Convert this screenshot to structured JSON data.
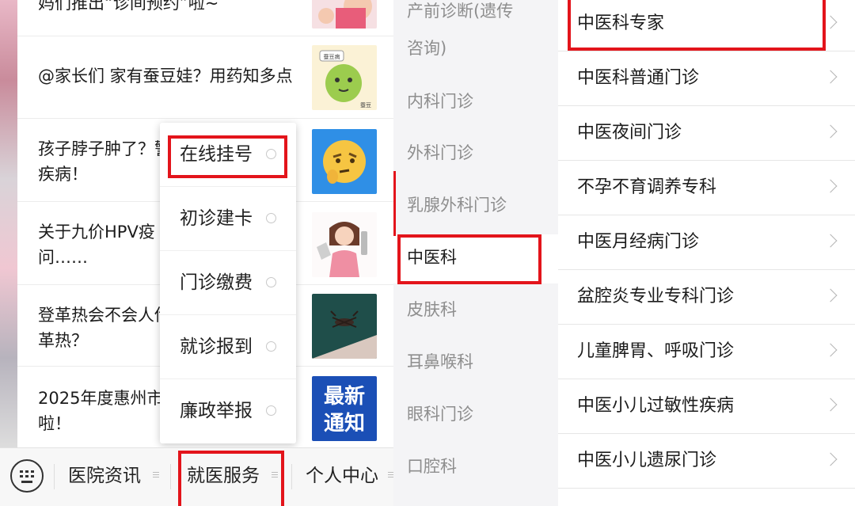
{
  "feed": {
    "items": [
      {
        "title": "妈们推出“诊间预约”啦~"
      },
      {
        "title": "@家长们 家有蚕豆娃？用药知多点"
      },
      {
        "title": "孩子脖子肿了？警惕",
        "title2": "疾病！"
      },
      {
        "title": "关于九价HPV疫",
        "title2": "问……"
      },
      {
        "title": "登革热会不会人传",
        "title2": "革热？"
      },
      {
        "title": "2025年度惠州市",
        "title2": "啦！"
      }
    ],
    "thumb_captions": {
      "sign": "蚕豆病",
      "tag": "蚕豆",
      "news_line1": "最新",
      "news_line2": "通知"
    }
  },
  "service_menu": {
    "items": [
      {
        "label": "在线挂号"
      },
      {
        "label": "初诊建卡"
      },
      {
        "label": "门诊缴费"
      },
      {
        "label": "就诊报到"
      },
      {
        "label": "廉政举报"
      }
    ]
  },
  "bottom_nav": {
    "tabs": [
      {
        "label": "医院资讯"
      },
      {
        "label": "就医服务"
      },
      {
        "label": "个人中心"
      }
    ]
  },
  "departments": {
    "items": [
      {
        "label": "产前诊断(遗传",
        "label2": "咨询)"
      },
      {
        "label": "内科门诊"
      },
      {
        "label": "外科门诊"
      },
      {
        "label": "乳腺外科门诊"
      },
      {
        "label": "中医科"
      },
      {
        "label": "皮肤科"
      },
      {
        "label": "耳鼻喉科"
      },
      {
        "label": "眼科门诊"
      },
      {
        "label": "口腔科"
      }
    ],
    "selected": "中医科"
  },
  "clinics": {
    "items": [
      {
        "label": "中医科专家"
      },
      {
        "label": "中医科普通门诊"
      },
      {
        "label": "中医夜间门诊"
      },
      {
        "label": "不孕不育调养专科"
      },
      {
        "label": "中医月经病门诊"
      },
      {
        "label": "盆腔炎专业专科门诊"
      },
      {
        "label": "儿童脾胃、呼吸门诊"
      },
      {
        "label": "中医小儿过敏性疾病"
      },
      {
        "label": "中医小儿遗尿门诊"
      }
    ]
  },
  "colors": {
    "highlight": "#e3141b",
    "sidebar_bg": "#f4f4f6",
    "muted_text": "#8e8e8e"
  }
}
